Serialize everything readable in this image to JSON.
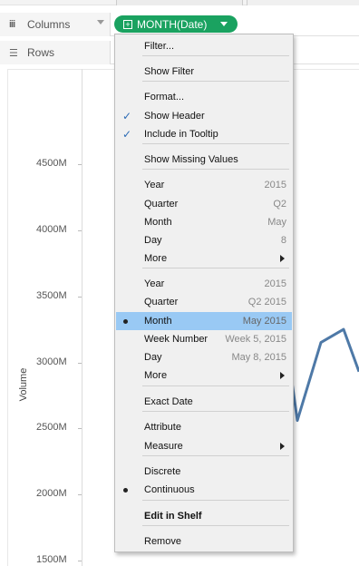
{
  "shelves": {
    "columns_label": "Columns",
    "rows_label": "Rows",
    "pill_label": "MONTH(Date)",
    "pill_color": "#1aa260"
  },
  "chart_data": {
    "type": "line",
    "ylabel": "Volume",
    "ytick_labels": [
      "4500M",
      "4000M",
      "3500M",
      "3000M",
      "2500M",
      "2000M",
      "1500M"
    ],
    "visible_series_tail": [
      3050,
      2560,
      3150,
      3250,
      2930
    ],
    "line_color": "#4e79a7"
  },
  "menu": {
    "items": [
      {
        "label": "Filter..."
      },
      {
        "label": "Show Filter"
      },
      {
        "label": "Format..."
      },
      {
        "label": "Show Header",
        "checked": true
      },
      {
        "label": "Include in Tooltip",
        "checked": true
      },
      {
        "label": "Show Missing Values"
      },
      {
        "label": "Year",
        "value": "2015"
      },
      {
        "label": "Quarter",
        "value": "Q2"
      },
      {
        "label": "Month",
        "value": "May"
      },
      {
        "label": "Day",
        "value": "8"
      },
      {
        "label": "More",
        "submenu": true
      },
      {
        "label": "Year",
        "value": "2015"
      },
      {
        "label": "Quarter",
        "value": "Q2 2015"
      },
      {
        "label": "Month",
        "value": "May 2015",
        "selected": true
      },
      {
        "label": "Week Number",
        "value": "Week 5, 2015"
      },
      {
        "label": "Day",
        "value": "May 8, 2015"
      },
      {
        "label": "More",
        "submenu": true
      },
      {
        "label": "Exact Date"
      },
      {
        "label": "Attribute"
      },
      {
        "label": "Measure",
        "submenu": true
      },
      {
        "label": "Discrete"
      },
      {
        "label": "Continuous",
        "selected_radio": true
      },
      {
        "label": "Edit in Shelf",
        "bold": true
      },
      {
        "label": "Remove"
      }
    ],
    "highlight_color": "#99c9f4"
  }
}
